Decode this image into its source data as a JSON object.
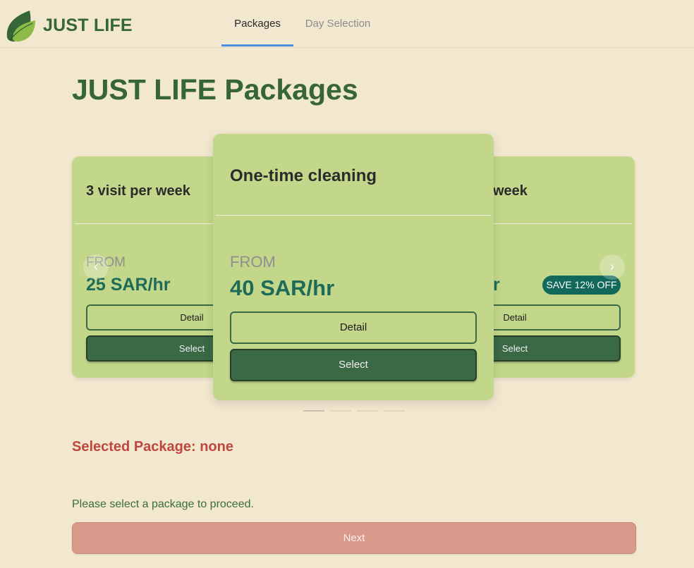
{
  "brand": {
    "name": "JUST LIFE",
    "logo_icon": "leaf-icon"
  },
  "tabs": [
    {
      "label": "Packages",
      "active": true
    },
    {
      "label": "Day Selection",
      "active": false
    }
  ],
  "page_title": "JUST LIFE Packages",
  "cards": {
    "left": {
      "title": "3 visit per week",
      "from_label": "FROM",
      "price": "25 SAR/hr",
      "detail_label": "Detail",
      "select_label": "Select"
    },
    "center": {
      "title": "One-time cleaning",
      "from_label": "FROM",
      "price": "40 SAR/hr",
      "detail_label": "Detail",
      "select_label": "Select"
    },
    "right": {
      "title_visible": "week",
      "price_visible": "r",
      "badge": "SAVE 12% OFF",
      "detail_label": "Detail",
      "select_label": "Select"
    }
  },
  "carousel": {
    "prev_icon": "‹",
    "next_icon": "›",
    "dots": 4,
    "active_dot": 0
  },
  "selected_package": "Selected Package: none",
  "hint": "Please select a package to proceed.",
  "next_label": "Next",
  "colors": {
    "background": "#f2e7cf",
    "card": "#c2d78a",
    "brand_green": "#356538",
    "price_teal": "#1e6b58",
    "alert_red": "#c0463f",
    "next_button": "#d99a8c",
    "tab_underline": "#4a90e2"
  }
}
